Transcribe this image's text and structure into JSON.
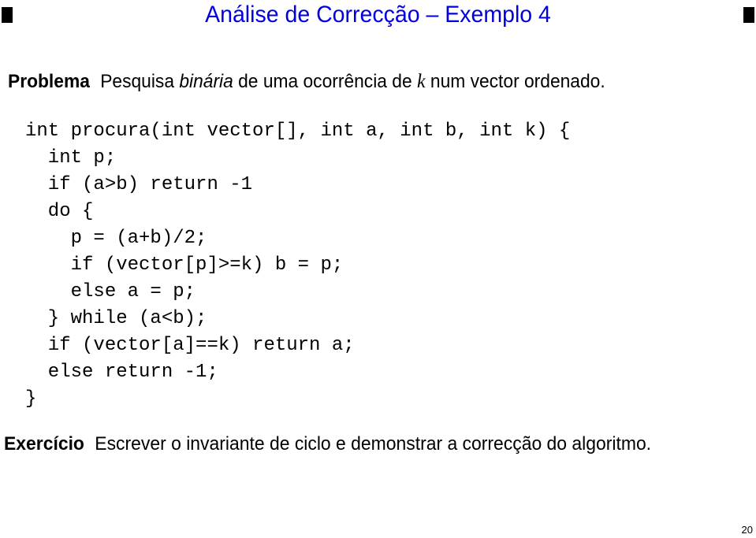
{
  "slide": {
    "title": "Análise de Correcção – Exemplo 4",
    "title_color": "#0000e0",
    "problem": {
      "label": "Problema",
      "text_before": "Pesquisa ",
      "emphasis": "binária",
      "text_middle": " de uma ocorrência de ",
      "math_var": "k",
      "text_after": " num vector ordenado."
    },
    "code_lines": [
      "int procura(int vector[], int a, int b, int k) {",
      "  int p;",
      "  if (a>b) return -1",
      "  do {",
      "    p = (a+b)/2;",
      "    if (vector[p]>=k) b = p;",
      "    else a = p;",
      "  } while (a<b);",
      "  if (vector[a]==k) return a;",
      "  else return -1;",
      "}"
    ],
    "exercise": {
      "label": "Exercício",
      "text": "Escrever o invariante de ciclo e demonstrar a correcção do algoritmo."
    },
    "page_number": "20"
  }
}
